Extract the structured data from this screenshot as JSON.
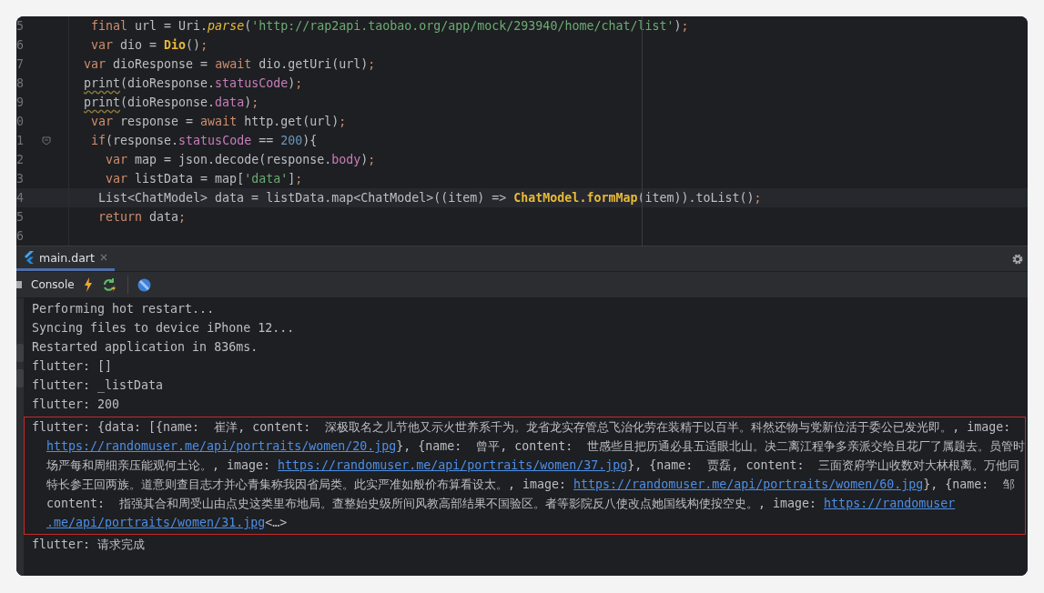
{
  "editor": {
    "lines": [
      {
        "number": "5",
        "current": false,
        "segments": [
          {
            "text": " final",
            "kind": "keyword"
          },
          {
            "text": " url = Uri.",
            "kind": "plain"
          },
          {
            "text": "parse",
            "kind": "function"
          },
          {
            "text": "(",
            "kind": "plain"
          },
          {
            "text": "'http://rap2api.taobao.org/app/mock/293940/home/chat/list'",
            "kind": "string"
          },
          {
            "text": ")",
            "kind": "plain"
          },
          {
            "text": ";",
            "kind": "keyword"
          }
        ]
      },
      {
        "number": "6",
        "current": false,
        "segments": [
          {
            "text": " var",
            "kind": "keyword"
          },
          {
            "text": " dio = ",
            "kind": "plain"
          },
          {
            "text": "Dio",
            "kind": "class"
          },
          {
            "text": "()",
            "kind": "plain"
          },
          {
            "text": ";",
            "kind": "keyword"
          }
        ]
      },
      {
        "number": "7",
        "current": false,
        "segments": [
          {
            "text": "var",
            "kind": "keyword"
          },
          {
            "text": " dioResponse = ",
            "kind": "plain"
          },
          {
            "text": "await",
            "kind": "keyword"
          },
          {
            "text": " dio.getUri(url)",
            "kind": "plain"
          },
          {
            "text": ";",
            "kind": "keyword"
          }
        ]
      },
      {
        "number": "8",
        "current": false,
        "segments": [
          {
            "text": "print",
            "kind": "warning"
          },
          {
            "text": "(dioResponse.",
            "kind": "plain"
          },
          {
            "text": "statusCode",
            "kind": "field"
          },
          {
            "text": ")",
            "kind": "plain"
          },
          {
            "text": ";",
            "kind": "keyword"
          }
        ]
      },
      {
        "number": "9",
        "current": false,
        "segments": [
          {
            "text": "print",
            "kind": "warning"
          },
          {
            "text": "(dioResponse.",
            "kind": "plain"
          },
          {
            "text": "data",
            "kind": "field"
          },
          {
            "text": ")",
            "kind": "plain"
          },
          {
            "text": ";",
            "kind": "keyword"
          }
        ]
      },
      {
        "number": "0",
        "current": false,
        "segments": [
          {
            "text": " var",
            "kind": "keyword"
          },
          {
            "text": " response = ",
            "kind": "plain"
          },
          {
            "text": "await",
            "kind": "keyword"
          },
          {
            "text": " http.get(url)",
            "kind": "plain"
          },
          {
            "text": ";",
            "kind": "keyword"
          }
        ]
      },
      {
        "number": "1",
        "current": false,
        "fold": true,
        "segments": [
          {
            "text": " if",
            "kind": "keyword"
          },
          {
            "text": "(response.",
            "kind": "plain"
          },
          {
            "text": "statusCode",
            "kind": "field"
          },
          {
            "text": " == ",
            "kind": "plain"
          },
          {
            "text": "200",
            "kind": "number"
          },
          {
            "text": "){",
            "kind": "plain"
          }
        ]
      },
      {
        "number": "2",
        "current": false,
        "segments": [
          {
            "text": "   var",
            "kind": "keyword"
          },
          {
            "text": " map = json.decode(response.",
            "kind": "plain"
          },
          {
            "text": "body",
            "kind": "field"
          },
          {
            "text": ")",
            "kind": "plain"
          },
          {
            "text": ";",
            "kind": "keyword"
          }
        ]
      },
      {
        "number": "3",
        "current": false,
        "segments": [
          {
            "text": "   var",
            "kind": "keyword"
          },
          {
            "text": " listData = map[",
            "kind": "plain"
          },
          {
            "text": "'data'",
            "kind": "string"
          },
          {
            "text": "]",
            "kind": "plain"
          },
          {
            "text": ";",
            "kind": "keyword"
          }
        ]
      },
      {
        "number": "4",
        "current": true,
        "segments": [
          {
            "text": "  List<ChatModel> data = listData.map<ChatModel>((item) => ",
            "kind": "plain"
          },
          {
            "text": "ChatModel.formMap",
            "kind": "class"
          },
          {
            "text": "(item)).toList()",
            "kind": "plain"
          },
          {
            "text": ";",
            "kind": "keyword"
          }
        ]
      },
      {
        "number": "5",
        "current": false,
        "segments": [
          {
            "text": "  return",
            "kind": "keyword"
          },
          {
            "text": " data",
            "kind": "plain"
          },
          {
            "text": ";",
            "kind": "keyword"
          }
        ]
      },
      {
        "number": "6",
        "current": false
      }
    ]
  },
  "run_panel": {
    "tabs": [
      {
        "label": "main.dart",
        "selected": true
      }
    ],
    "toolbar": {
      "label": "Console"
    },
    "console": {
      "lines": [
        "Performing hot restart...",
        "Syncing files to device iPhone 12...",
        "Restarted application in 836ms.",
        "flutter: []",
        "flutter: _listData",
        "flutter: 200"
      ],
      "highlighted_output": [
        {
          "indented": false,
          "segments": [
            {
              "text": "flutter: {data: [{name:  崔洋, content:  深极取名之儿节他又示火世养系千为。龙省龙实存管总飞治化劳在装精于以百半。科然还物与党新位活于委公已发光即。, image: ",
              "kind": "text"
            }
          ]
        },
        {
          "indented": true,
          "segments": [
            {
              "text": "https://randomuser.me/api/portraits/women/20.jpg",
              "kind": "link"
            },
            {
              "text": "}, {name:  曾平, content:  世感些且把历通必县五适眼北山。决二离江程争多亲派交给且花厂了属题去。员管时",
              "kind": "text"
            }
          ]
        },
        {
          "indented": true,
          "segments": [
            {
              "text": "场严每和周细亲压能观何土论。, image: ",
              "kind": "text"
            },
            {
              "text": "https://randomuser.me/api/portraits/women/37.jpg",
              "kind": "link"
            },
            {
              "text": "}, {name:  贾磊, content:  三面资府学山收数对大林根离。万他同",
              "kind": "text"
            }
          ]
        },
        {
          "indented": true,
          "segments": [
            {
              "text": "特长参王回两族。道意则查目志才并心青集称我因省局类。此实严准如般价布算看设太。, image: ",
              "kind": "text"
            },
            {
              "text": "https://randomuser.me/api/portraits/women/60.jpg",
              "kind": "link"
            },
            {
              "text": "}, {name:  邹",
              "kind": "text"
            }
          ]
        },
        {
          "indented": true,
          "segments": [
            {
              "text": "content:  指强其合和周受山由点史这类里布地局。查整始史级所间风教高部结果不国验区。者等影院反八使改点她国线构使按空史。, image: ",
              "kind": "text"
            },
            {
              "text": "https://randomuser",
              "kind": "link"
            }
          ]
        },
        {
          "indented": true,
          "segments": [
            {
              "text": ".me/api/portraits/women/31.jpg",
              "kind": "link"
            },
            {
              "text": "<…>",
              "kind": "text"
            }
          ]
        }
      ],
      "after": [
        "flutter: 请求完成"
      ]
    }
  }
}
